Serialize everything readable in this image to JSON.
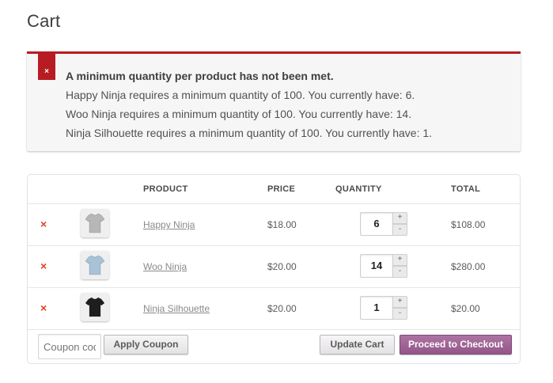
{
  "page": {
    "title": "Cart"
  },
  "notice": {
    "close_glyph": "×",
    "heading": "A minimum quantity per product has not been met.",
    "messages": [
      "Happy Ninja requires a minimum quantity of 100. You currently have: 6.",
      "Woo Ninja requires a minimum quantity of 100. You currently have: 14.",
      "Ninja Silhouette requires a minimum quantity of 100. You currently have: 1."
    ],
    "color": "#b81c23"
  },
  "table": {
    "headers": {
      "product": "PRODUCT",
      "price": "PRICE",
      "quantity": "QUANTITY",
      "total": "TOTAL"
    },
    "remove_glyph": "×",
    "plus_glyph": "+",
    "minus_glyph": "-",
    "rows": [
      {
        "name": "Happy Ninja",
        "price": "$18.00",
        "quantity": "6",
        "total": "$108.00",
        "thumbnail_icon": "gray-tshirt-icon",
        "shirt_color": "#b7b7b7"
      },
      {
        "name": "Woo Ninja",
        "price": "$20.00",
        "quantity": "14",
        "total": "$280.00",
        "thumbnail_icon": "light-blue-tshirt-icon",
        "shirt_color": "#a8c3d8"
      },
      {
        "name": "Ninja Silhouette",
        "price": "$20.00",
        "quantity": "1",
        "total": "$20.00",
        "thumbnail_icon": "black-tshirt-icon",
        "shirt_color": "#1e1e1e"
      }
    ]
  },
  "actions": {
    "coupon_placeholder": "Coupon code",
    "apply_coupon_label": "Apply Coupon",
    "update_cart_label": "Update Cart",
    "checkout_label": "Proceed to Checkout"
  },
  "colors": {
    "remove": "#e2401c",
    "primary_button": "#a46497"
  }
}
